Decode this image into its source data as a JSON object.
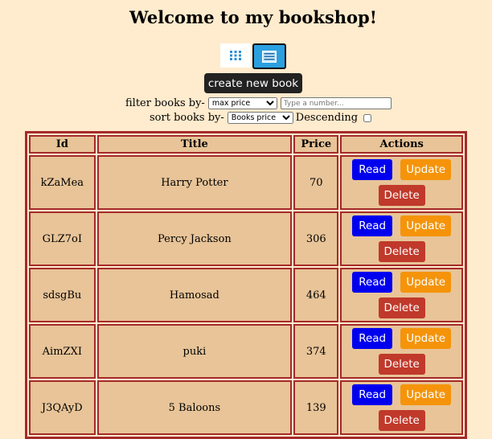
{
  "page": {
    "title": "Welcome to my bookshop!",
    "create_button": "create new book"
  },
  "view_toggle": {
    "options": [
      "grid-view",
      "list-view"
    ],
    "selected": "list-view",
    "active_color": "#2aa0e0",
    "icon_color": "#2a8fd8"
  },
  "filter": {
    "label": "filter books by-",
    "selected": "max price",
    "input_placeholder": "Type a number..."
  },
  "sort": {
    "label": "sort books by-",
    "selected": "Books price",
    "descending_label": "Descending",
    "descending_checked": false
  },
  "table": {
    "headers": {
      "id": "Id",
      "title": "Title",
      "price": "Price",
      "actions": "Actions"
    },
    "actions": {
      "read": "Read",
      "update": "Update",
      "delete": "Delete"
    },
    "rows": [
      {
        "id": "kZaMea",
        "title": "Harry Potter",
        "price": "70"
      },
      {
        "id": "GLZ7oI",
        "title": "Percy Jackson",
        "price": "306"
      },
      {
        "id": "sdsgBu",
        "title": "Hamosad",
        "price": "464"
      },
      {
        "id": "AimZXI",
        "title": "puki",
        "price": "374"
      },
      {
        "id": "J3QAyD",
        "title": "5 Baloons",
        "price": "139"
      }
    ]
  },
  "colors": {
    "background": "#ffebcd",
    "table_border": "#a52a2a",
    "cell_bg": "#e8c498",
    "read": "#0000ee",
    "update": "#f5940a",
    "delete": "#c0392b"
  }
}
